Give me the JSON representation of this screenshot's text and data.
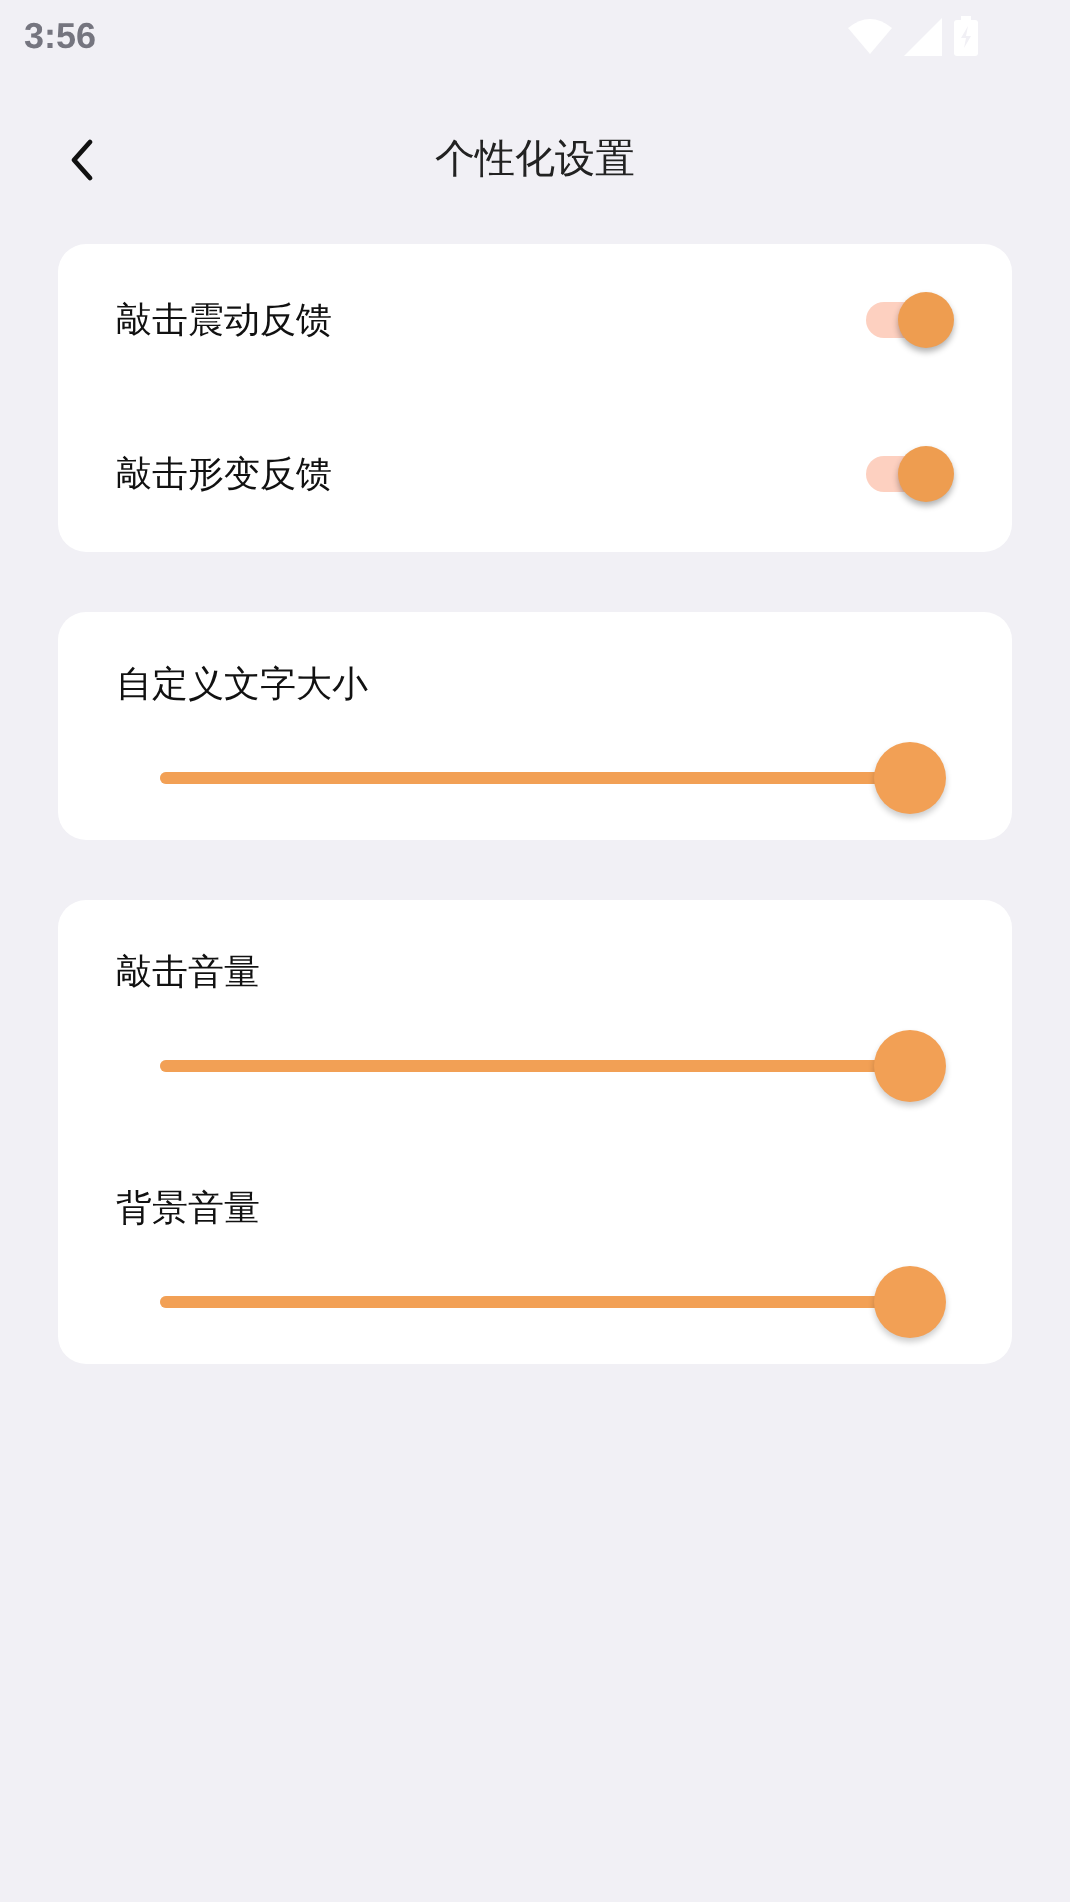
{
  "status_bar": {
    "time": "3:56"
  },
  "header": {
    "title": "个性化设置"
  },
  "cards": [
    {
      "items": [
        {
          "kind": "switch",
          "label": "敲击震动反馈",
          "on": true
        },
        {
          "kind": "switch",
          "label": "敲击形变反馈",
          "on": true
        }
      ]
    },
    {
      "items": [
        {
          "kind": "slider",
          "label": "自定义文字大小",
          "level": 1
        }
      ]
    },
    {
      "items": [
        {
          "kind": "slider",
          "label": "敲击音量",
          "level": 1
        },
        {
          "kind": "slider",
          "label": "背景音量",
          "level": 1
        }
      ]
    }
  ]
}
